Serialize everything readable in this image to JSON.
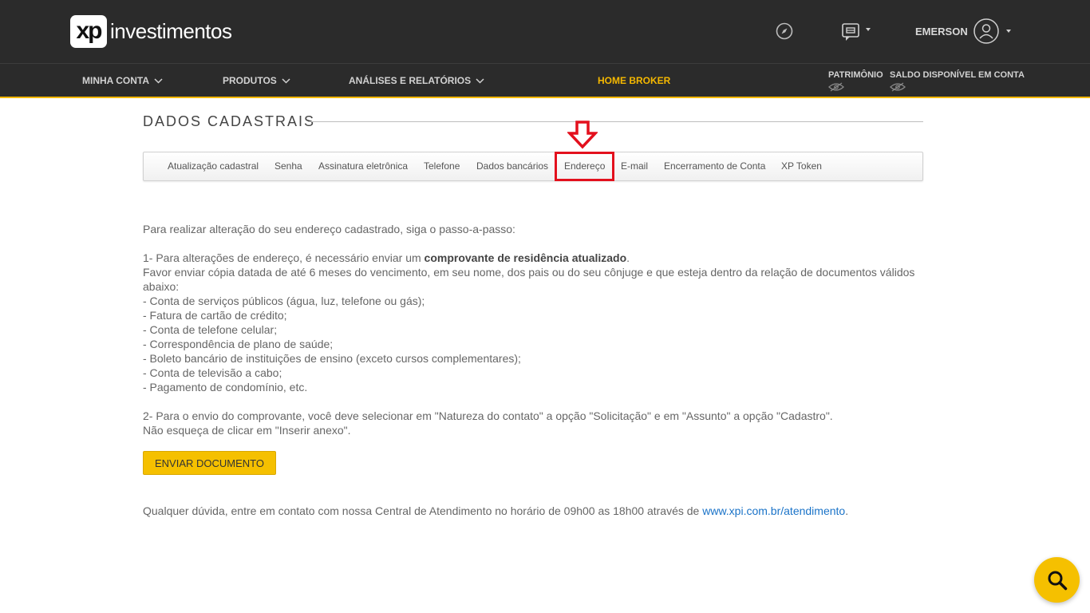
{
  "header": {
    "logo_badge": "xp",
    "logo_text": "investimentos",
    "user_name": "EMERSON"
  },
  "nav": {
    "items": [
      {
        "label": "MINHA CONTA"
      },
      {
        "label": "PRODUTOS"
      },
      {
        "label": "ANÁLISES E RELATÓRIOS"
      }
    ],
    "home_broker": "HOME BROKER",
    "patrimonio": "PATRIMÔNIO",
    "saldo": "SALDO DISPONÍVEL EM CONTA"
  },
  "page": {
    "title": "DADOS CADASTRAIS"
  },
  "tabs": [
    "Atualização cadastral",
    "Senha",
    "Assinatura eletrônica",
    "Telefone",
    "Dados bancários",
    "Endereço",
    "E-mail",
    "Encerramento de Conta",
    "XP Token"
  ],
  "content": {
    "intro": "Para realizar alteração do seu endereço cadastrado, siga o passo-a-passo:",
    "step1_prefix": "1- Para alterações de endereço, é necessário enviar um ",
    "step1_bold": "comprovante de residência atualizado",
    "step1_suffix": ".",
    "step1_detail": "Favor enviar cópia datada de até 6 meses do vencimento, em seu nome, dos pais ou do seu cônjuge e que esteja dentro da relação de documentos válidos abaixo:",
    "documents": [
      "- Conta de serviços públicos (água, luz, telefone ou gás);",
      "- Fatura de cartão de crédito;",
      "- Conta de telefone celular;",
      "- Correspondência de plano de saúde;",
      "- Boleto bancário de instituições de ensino (exceto cursos complementares);",
      "- Conta de televisão a cabo;",
      "- Pagamento de condomínio, etc."
    ],
    "step2": "2- Para o envio do comprovante, você deve selecionar em \"Natureza do contato\" a opção \"Solicitação\" e em \"Assunto\" a opção \"Cadastro\".",
    "step2_note": "Não esqueça de clicar em \"Inserir anexo\".",
    "send_button": "ENVIAR DOCUMENTO",
    "footer_prefix": "Qualquer dúvida, entre em contato com nossa Central de Atendimento no horário de 09h00 as 18h00 através de ",
    "footer_link": "www.xpi.com.br/atendimento",
    "footer_suffix": "."
  },
  "colors": {
    "header_bg": "#2b2b2b",
    "accent": "#f5b800",
    "highlight": "#e3101d",
    "link": "#1a73c8"
  }
}
